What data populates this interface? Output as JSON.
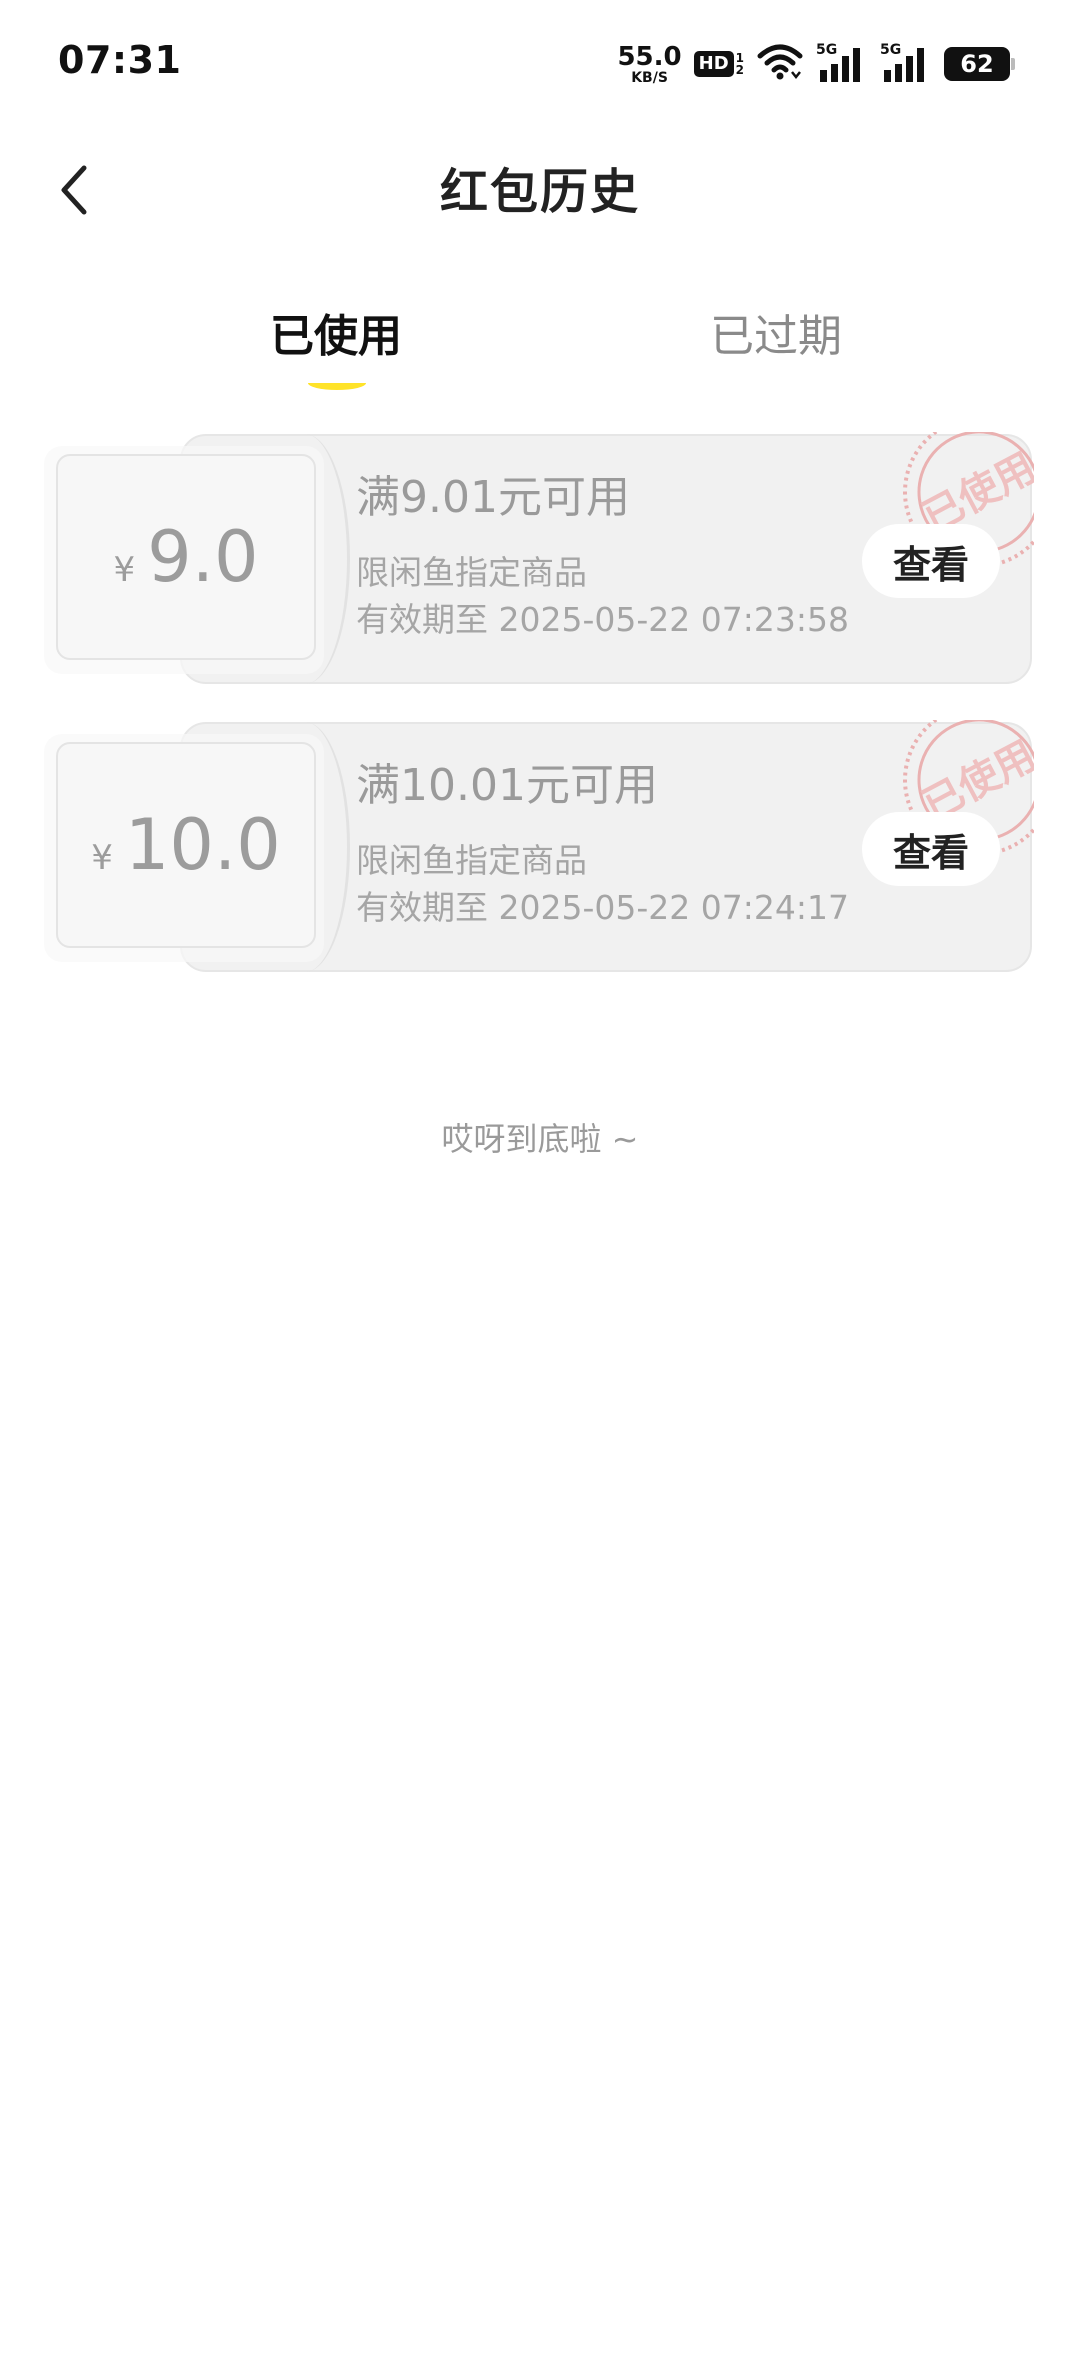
{
  "status_bar": {
    "time": "07:31",
    "net_speed_value": "55.0",
    "net_speed_unit": "KB/S",
    "hd_label": "HD",
    "hd_sub1": "1",
    "hd_sub2": "2",
    "sim1_label": "5G",
    "sim2_label": "5G",
    "battery": "62"
  },
  "header": {
    "title": "红包历史"
  },
  "tabs": {
    "used": "已使用",
    "expired": "已过期",
    "active": "used"
  },
  "coupons": [
    {
      "currency": "¥",
      "amount": "9.0",
      "title": "满9.01元可用",
      "scope": "限闲鱼指定商品",
      "expiry": "有效期至 2025-05-22 07:23:58",
      "button": "查看",
      "stamp": "已使用"
    },
    {
      "currency": "¥",
      "amount": "10.0",
      "title": "满10.01元可用",
      "scope": "限闲鱼指定商品",
      "expiry": "有效期至 2025-05-22 07:24:17",
      "button": "查看",
      "stamp": "已使用"
    }
  ],
  "footer": {
    "end_text": "哎呀到底啦 ~"
  },
  "icons": {
    "back": "chevron-left-icon",
    "wifi": "wifi-icon",
    "signal": "signal-icon",
    "battery": "battery-icon"
  },
  "colors": {
    "tab_indicator": "#ffe329",
    "stamp": "#e9a3a3",
    "card_bg": "#f1f1f1"
  }
}
